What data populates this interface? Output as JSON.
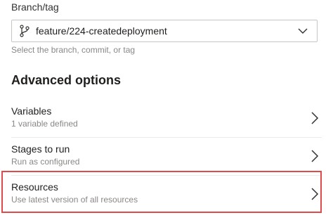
{
  "branch": {
    "label": "Branch/tag",
    "value": "feature/224-createdeployment",
    "helper": "Select the branch, commit, or tag",
    "icon": "git-branch-icon"
  },
  "advanced": {
    "title": "Advanced options",
    "options": [
      {
        "title": "Variables",
        "subtitle": "1 variable defined"
      },
      {
        "title": "Stages to run",
        "subtitle": "Run as configured"
      },
      {
        "title": "Resources",
        "subtitle": "Use latest version of all resources"
      }
    ]
  },
  "colors": {
    "highlight_border": "#e04a4a",
    "secondary_text": "#8a8886"
  }
}
